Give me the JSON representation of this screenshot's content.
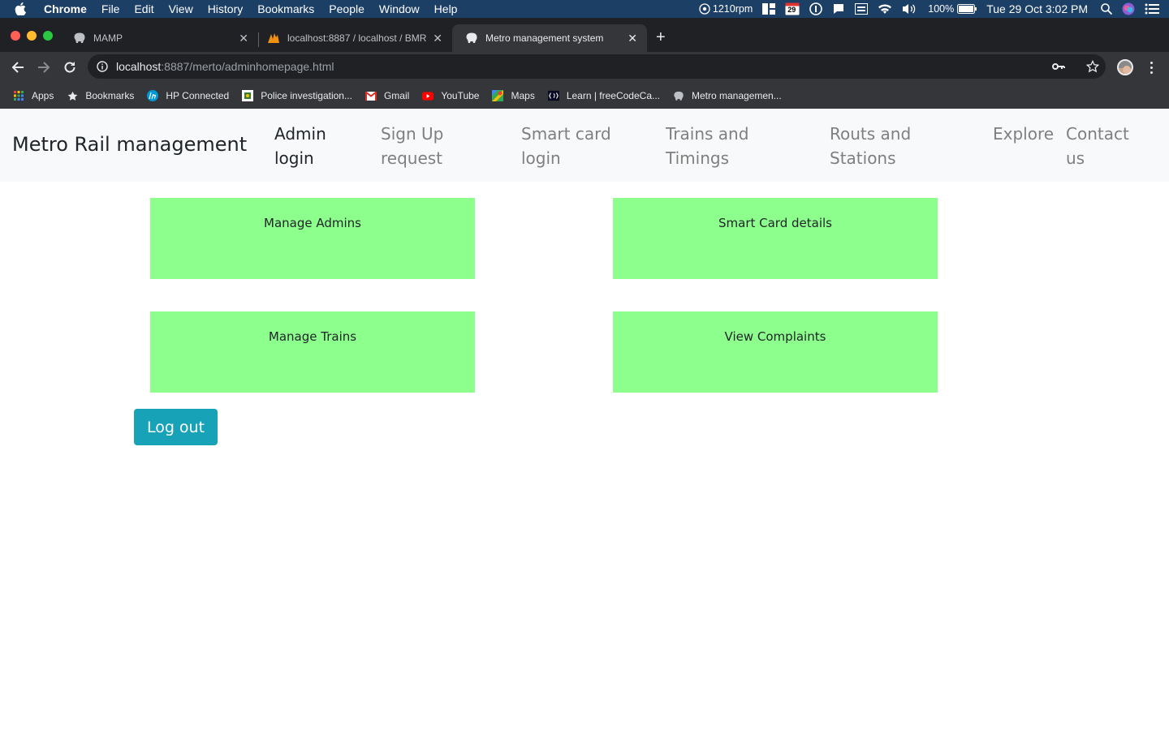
{
  "os_menubar": {
    "app_name": "Chrome",
    "items": [
      "File",
      "Edit",
      "View",
      "History",
      "Bookmarks",
      "People",
      "Window",
      "Help"
    ],
    "fan_speed": "1210rpm",
    "calendar_day": "29",
    "battery": "100%",
    "clock": "Tue 29 Oct  3:02 PM"
  },
  "browser": {
    "tabs": [
      {
        "title": "MAMP",
        "icon": "elephant-icon",
        "active": false
      },
      {
        "title": "localhost:8887 / localhost / BMR",
        "icon": "phpmyadmin-icon",
        "active": false
      },
      {
        "title": "Metro management system",
        "icon": "elephant-icon",
        "active": true
      }
    ],
    "url_host": "localhost",
    "url_path": ":8887/merto/adminhomepage.html",
    "bookmarks": [
      {
        "label": "Apps",
        "icon": "apps-grid-icon"
      },
      {
        "label": "Bookmarks",
        "icon": "star-icon"
      },
      {
        "label": "HP Connected",
        "icon": "hp-icon"
      },
      {
        "label": "Police investigation...",
        "icon": "police-icon"
      },
      {
        "label": "Gmail",
        "icon": "gmail-icon"
      },
      {
        "label": "YouTube",
        "icon": "youtube-icon"
      },
      {
        "label": "Maps",
        "icon": "maps-icon"
      },
      {
        "label": "Learn | freeCodeCa...",
        "icon": "freecodecamp-icon"
      },
      {
        "label": "Metro managemen...",
        "icon": "elephant-icon"
      }
    ]
  },
  "navbar": {
    "brand": "Metro Rail management",
    "links": [
      {
        "line1": "Admin",
        "line2": "login",
        "active": true
      },
      {
        "line1": "Sign Up",
        "line2": "request",
        "active": false
      },
      {
        "line1": "Smart card",
        "line2": "login",
        "active": false
      },
      {
        "line1": "Trains and",
        "line2": "Timings",
        "active": false
      },
      {
        "line1": "Routs and",
        "line2": "Stations",
        "active": false
      },
      {
        "line1": "Explore",
        "line2": "",
        "active": false
      },
      {
        "line1": "Contact",
        "line2": "us",
        "active": false
      }
    ]
  },
  "dashboard": {
    "cards": [
      "Manage Admins",
      "Smart Card details",
      "Manage Trains",
      "View Complaints"
    ],
    "card_color": "#8dff8d",
    "logout_label": "Log out",
    "logout_color": "#17a2b8"
  }
}
